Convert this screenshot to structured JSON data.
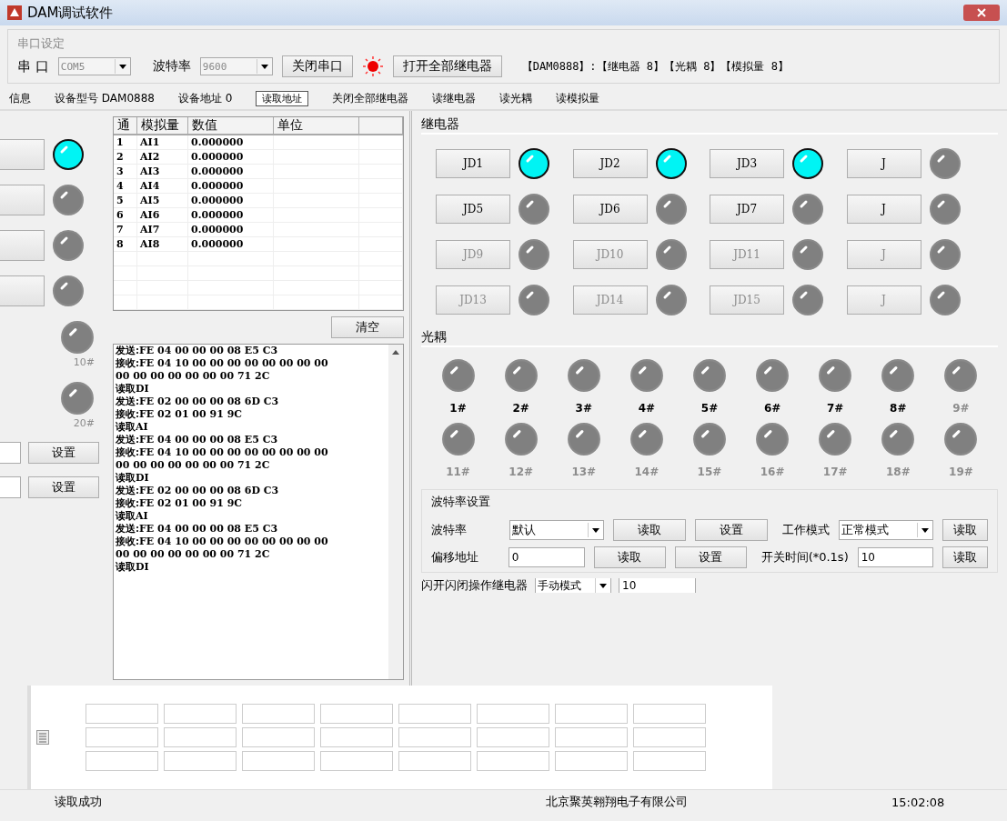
{
  "window": {
    "title": "DAM调试软件"
  },
  "serial": {
    "legend": "串口设定",
    "port_label": "串 口",
    "port": "COM5",
    "baud_label": "波特率",
    "baud": "9600",
    "close_button": "关闭串口",
    "port_open": true,
    "open_all_button": "打开全部继电器",
    "info": "【DAM0888】:【继电器 8】【光耦 8】【模拟量 8】"
  },
  "toolbar": [
    {
      "label": "信息"
    },
    {
      "label": "设备型号 DAM0888"
    },
    {
      "label": "设备地址 0"
    },
    {
      "label": "读取地址",
      "kind": "button"
    },
    {
      "label": "关闭全部继电器"
    },
    {
      "label": "读继电器"
    },
    {
      "label": "读光耦"
    },
    {
      "label": "读模拟量"
    }
  ],
  "left_panel": {
    "lamps": [
      {
        "on": true
      },
      {
        "on": false
      },
      {
        "on": false
      },
      {
        "on": false
      }
    ],
    "input_labels": [
      "10#",
      "20#"
    ],
    "set_buttons": [
      "设置",
      "设置"
    ]
  },
  "analog_table": {
    "columns": [
      "通",
      "模拟量",
      "数值",
      "单位"
    ],
    "rows": [
      {
        "channel": "1",
        "name": "AI1",
        "value": "0.000000"
      },
      {
        "channel": "2",
        "name": "AI2",
        "value": "0.000000"
      },
      {
        "channel": "3",
        "name": "AI3",
        "value": "0.000000"
      },
      {
        "channel": "4",
        "name": "AI4",
        "value": "0.000000"
      },
      {
        "channel": "5",
        "name": "AI5",
        "value": "0.000000"
      },
      {
        "channel": "6",
        "name": "AI6",
        "value": "0.000000"
      },
      {
        "channel": "7",
        "name": "AI7",
        "value": "0.000000"
      },
      {
        "channel": "8",
        "name": "AI8",
        "value": "0.000000"
      }
    ]
  },
  "clear_button": "清空",
  "log": [
    "发送:FE 04 00 00 00 08 E5 C3",
    "接收:FE 04 10 00 00 00 00 00 00 00 00",
    "00 00 00 00 00 00 00 71 2C",
    "读取DI",
    "发送:FE 02 00 00 00 08 6D C3",
    "接收:FE 02 01 00 91 9C",
    "读取AI",
    "发送:FE 04 00 00 00 08 E5 C3",
    "接收:FE 04 10 00 00 00 00 00 00 00 00",
    "00 00 00 00 00 00 00 71 2C",
    "读取DI",
    "发送:FE 02 00 00 00 08 6D C3",
    "接收:FE 02 01 00 91 9C",
    "读取AI",
    "发送:FE 04 00 00 00 08 E5 C3",
    "接收:FE 04 10 00 00 00 00 00 00 00 00",
    "00 00 00 00 00 00 00 71 2C",
    "读取DI"
  ],
  "relays": {
    "title": "继电器",
    "items": [
      {
        "label": "JD1",
        "on": true,
        "disabled": false
      },
      {
        "label": "JD2",
        "on": true,
        "disabled": false
      },
      {
        "label": "JD3",
        "on": true,
        "disabled": false
      },
      {
        "label": "J",
        "on": false,
        "disabled": false
      },
      {
        "label": "JD5",
        "on": false,
        "disabled": false
      },
      {
        "label": "JD6",
        "on": false,
        "disabled": false
      },
      {
        "label": "JD7",
        "on": false,
        "disabled": false
      },
      {
        "label": "J",
        "on": false,
        "disabled": false
      },
      {
        "label": "JD9",
        "on": false,
        "disabled": true
      },
      {
        "label": "JD10",
        "on": false,
        "disabled": true
      },
      {
        "label": "JD11",
        "on": false,
        "disabled": true
      },
      {
        "label": "J",
        "on": false,
        "disabled": true
      },
      {
        "label": "JD13",
        "on": false,
        "disabled": true
      },
      {
        "label": "JD14",
        "on": false,
        "disabled": true
      },
      {
        "label": "JD15",
        "on": false,
        "disabled": true
      },
      {
        "label": "J",
        "on": false,
        "disabled": true
      }
    ]
  },
  "optocouplers": {
    "title": "光耦",
    "items": [
      {
        "label": "1#",
        "on": false,
        "disabled": false
      },
      {
        "label": "2#",
        "on": false,
        "disabled": false
      },
      {
        "label": "3#",
        "on": false,
        "disabled": false
      },
      {
        "label": "4#",
        "on": false,
        "disabled": false
      },
      {
        "label": "5#",
        "on": false,
        "disabled": false
      },
      {
        "label": "6#",
        "on": false,
        "disabled": false
      },
      {
        "label": "7#",
        "on": false,
        "disabled": false
      },
      {
        "label": "8#",
        "on": false,
        "disabled": false
      },
      {
        "label": "9#",
        "on": false,
        "disabled": true
      },
      {
        "label": "11#",
        "on": false,
        "disabled": true
      },
      {
        "label": "12#",
        "on": false,
        "disabled": true
      },
      {
        "label": "13#",
        "on": false,
        "disabled": true
      },
      {
        "label": "14#",
        "on": false,
        "disabled": true
      },
      {
        "label": "15#",
        "on": false,
        "disabled": true
      },
      {
        "label": "16#",
        "on": false,
        "disabled": true
      },
      {
        "label": "17#",
        "on": false,
        "disabled": true
      },
      {
        "label": "18#",
        "on": false,
        "disabled": true
      },
      {
        "label": "19#",
        "on": false,
        "disabled": true
      }
    ]
  },
  "baud_settings": {
    "legend": "波特率设置",
    "rows": [
      {
        "label": "波特率",
        "kind": "select",
        "value": "默认",
        "read": "读取",
        "set": "设置",
        "right": {
          "label": "工作模式",
          "kind": "select",
          "value": "正常模式",
          "read": "读取"
        }
      },
      {
        "label": "偏移地址",
        "kind": "input",
        "value": "0",
        "read": "读取",
        "set": "设置",
        "right": {
          "label": "开关时间(*0.1s)",
          "kind": "input",
          "value": "10",
          "read": "读取"
        }
      }
    ],
    "flash_label": "闪开闪闭操作继电器",
    "flash_mode": "手动模式",
    "flash_value": "10"
  },
  "status_bar": [
    "读取成功",
    "北京聚英翱翔电子有限公司",
    "15:02:08"
  ]
}
